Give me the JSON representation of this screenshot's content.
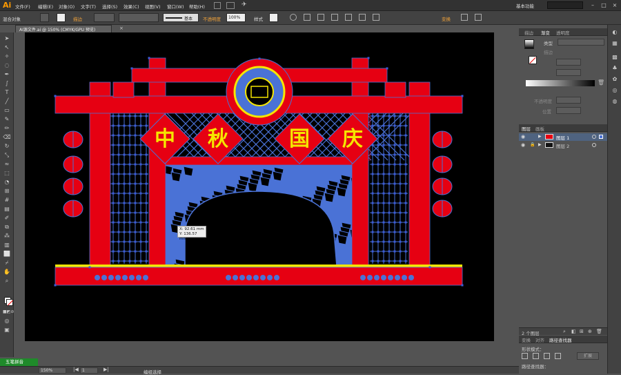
{
  "app": {
    "logo": "Ai"
  },
  "menu": {
    "items": [
      "文件(F)",
      "编辑(E)",
      "对象(O)",
      "文字(T)",
      "选择(S)",
      "效果(C)",
      "视图(V)",
      "窗口(W)",
      "帮助(H)"
    ],
    "workspace": "基本功能"
  },
  "control": {
    "mixed_objects": "混合对象",
    "stroke_label": "描边",
    "stroke_style": "基本",
    "opacity_label": "不透明度",
    "opacity_value": "100%",
    "style_label": "样式",
    "transform_label": "变换"
  },
  "document": {
    "tab_title": "AI源文件.ai @ 150% (CMYK/GPU 预览)",
    "close": "×"
  },
  "canvas": {
    "characters": [
      "中",
      "秋",
      "国",
      "庆"
    ],
    "tooltip_x": "X: 92.61 mm",
    "tooltip_y": "Y: 136.57 mm"
  },
  "colors": {
    "red": "#e60012",
    "blue": "#4a72d6",
    "yellow": "#f5e600",
    "anchor": "#3b5bd9"
  },
  "panels": {
    "top_tabs": [
      "描边",
      "渐变",
      "透明度"
    ],
    "gradient": {
      "type_label": "类型",
      "stroke_label": "描边",
      "opacity_label": "不透明度",
      "position_label": "位置"
    },
    "layers_tabs": [
      "图层",
      "画板"
    ],
    "layers": [
      {
        "name": "图层 1",
        "selected": true
      },
      {
        "name": "图层 2",
        "selected": false
      }
    ],
    "layer_count": "2 个图层",
    "bottom_tabs": [
      "变换",
      "对齐",
      "路径查找器"
    ],
    "pathfinder": {
      "shape_modes": "形状模式：",
      "expand": "扩展",
      "pathfinders": "路径查找器："
    }
  },
  "status": {
    "zoom": "150%",
    "artboard": "1",
    "tool": "编组选择",
    "ime": "五笔拼音"
  }
}
